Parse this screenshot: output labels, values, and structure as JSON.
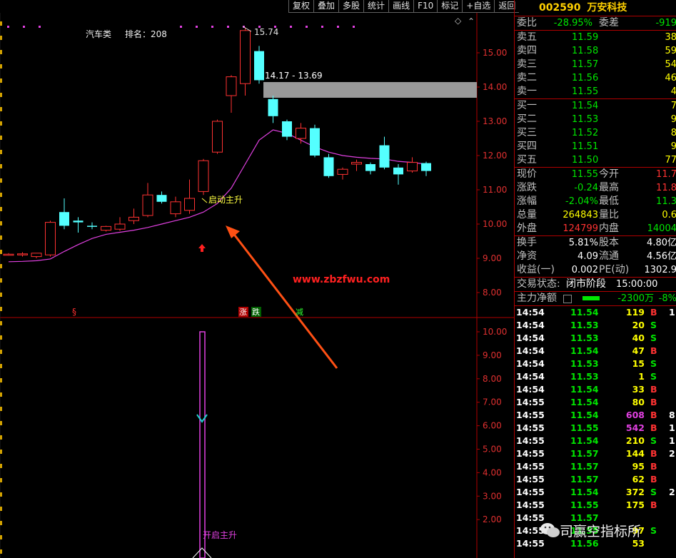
{
  "toolbar": [
    "复权",
    "叠加",
    "多股",
    "统计",
    "画线",
    "F10",
    "标记",
    "+自选",
    "返回"
  ],
  "chart": {
    "sector": "汽车类",
    "rank_label": "排名：208",
    "high_label": "15.74",
    "range_label": "14.17 - 13.69",
    "signal_label": "启动主升",
    "bottom_signal_label": "开启主升",
    "watermark": "www.zbzfwu.com",
    "marker_s": "§",
    "marker_zhang": "涨",
    "marker_die": "跌",
    "marker_jian": "减",
    "diamond": "◇",
    "price_ticks": [
      "15.00",
      "14.00",
      "13.00",
      "12.00",
      "11.00",
      "10.00",
      "9.00",
      "8.00"
    ],
    "lower_ticks": [
      "10.00",
      "9.00",
      "8.00",
      "7.00",
      "6.00",
      "5.00",
      "4.00",
      "3.00",
      "2.00"
    ],
    "colors": {
      "up": "#ff3232",
      "down": "#54ffff",
      "ma": "#e040e0",
      "grid": "#b00000",
      "arrow": "#ff5014"
    }
  },
  "candles": [
    {
      "o": 9.1,
      "h": 9.15,
      "l": 9.08,
      "c": 9.12
    },
    {
      "o": 9.1,
      "h": 9.18,
      "l": 9.05,
      "c": 9.13
    },
    {
      "o": 9.05,
      "h": 9.15,
      "l": 9.0,
      "c": 9.15
    },
    {
      "o": 9.1,
      "h": 10.1,
      "l": 9.05,
      "c": 10.05
    },
    {
      "o": 10.35,
      "h": 10.75,
      "l": 9.85,
      "c": 9.95
    },
    {
      "o": 10.1,
      "h": 10.2,
      "l": 9.75,
      "c": 10.05
    },
    {
      "o": 9.95,
      "h": 10.05,
      "l": 9.85,
      "c": 9.92
    },
    {
      "o": 9.82,
      "h": 9.95,
      "l": 9.78,
      "c": 9.93
    },
    {
      "o": 9.85,
      "h": 10.2,
      "l": 9.8,
      "c": 10.0
    },
    {
      "o": 10.1,
      "h": 10.45,
      "l": 10.0,
      "c": 10.2
    },
    {
      "o": 10.25,
      "h": 11.2,
      "l": 10.2,
      "c": 10.85
    },
    {
      "o": 10.85,
      "h": 10.95,
      "l": 10.6,
      "c": 10.65
    },
    {
      "o": 10.3,
      "h": 10.8,
      "l": 10.2,
      "c": 10.65
    },
    {
      "o": 10.4,
      "h": 11.3,
      "l": 10.3,
      "c": 10.75
    },
    {
      "o": 10.95,
      "h": 11.9,
      "l": 10.85,
      "c": 11.85
    },
    {
      "o": 12.1,
      "h": 13.05,
      "l": 12.05,
      "c": 13.0
    },
    {
      "o": 13.75,
      "h": 14.35,
      "l": 13.25,
      "c": 14.3
    },
    {
      "o": 14.1,
      "h": 15.74,
      "l": 13.75,
      "c": 15.65
    },
    {
      "o": 15.05,
      "h": 15.2,
      "l": 14.1,
      "c": 14.2
    },
    {
      "o": 13.65,
      "h": 13.75,
      "l": 12.95,
      "c": 13.15
    },
    {
      "o": 13.0,
      "h": 13.05,
      "l": 12.45,
      "c": 12.55
    },
    {
      "o": 12.5,
      "h": 12.95,
      "l": 12.35,
      "c": 12.8
    },
    {
      "o": 12.8,
      "h": 12.9,
      "l": 11.95,
      "c": 12.0
    },
    {
      "o": 11.95,
      "h": 12.05,
      "l": 11.35,
      "c": 11.4
    },
    {
      "o": 11.45,
      "h": 11.65,
      "l": 11.3,
      "c": 11.6
    },
    {
      "o": 11.75,
      "h": 11.88,
      "l": 11.55,
      "c": 11.8
    },
    {
      "o": 11.75,
      "h": 11.8,
      "l": 11.45,
      "c": 11.55
    },
    {
      "o": 12.3,
      "h": 12.55,
      "l": 11.6,
      "c": 11.65
    },
    {
      "o": 11.65,
      "h": 11.75,
      "l": 11.15,
      "c": 11.45
    },
    {
      "o": 11.55,
      "h": 11.95,
      "l": 11.5,
      "c": 11.8
    },
    {
      "o": 11.78,
      "h": 11.82,
      "l": 11.4,
      "c": 11.55
    }
  ],
  "ma": [
    8.9,
    8.91,
    8.93,
    8.98,
    9.2,
    9.4,
    9.58,
    9.7,
    9.76,
    9.82,
    9.9,
    10.0,
    10.1,
    10.2,
    10.35,
    10.6,
    11.05,
    11.75,
    12.45,
    12.75,
    12.65,
    12.45,
    12.25,
    12.1,
    12.0,
    11.95,
    11.92,
    11.9,
    11.83,
    11.8,
    11.75
  ],
  "stock": {
    "code": "002590",
    "name": "万安科技"
  },
  "order_ratio": {
    "label": "委比",
    "value": "-28.95%",
    "diff_label": "委差",
    "diff": "-919"
  },
  "asks": [
    {
      "label": "卖五",
      "price": "11.59",
      "vol": "38"
    },
    {
      "label": "卖四",
      "price": "11.58",
      "vol": "59"
    },
    {
      "label": "卖三",
      "price": "11.57",
      "vol": "54"
    },
    {
      "label": "卖二",
      "price": "11.56",
      "vol": "46"
    },
    {
      "label": "卖一",
      "price": "11.55",
      "vol": "4"
    }
  ],
  "bids": [
    {
      "label": "买一",
      "price": "11.54",
      "vol": "7"
    },
    {
      "label": "买二",
      "price": "11.53",
      "vol": "9"
    },
    {
      "label": "买三",
      "price": "11.52",
      "vol": "8"
    },
    {
      "label": "买四",
      "price": "11.51",
      "vol": "9"
    },
    {
      "label": "买五",
      "price": "11.50",
      "vol": "77"
    }
  ],
  "quote": [
    {
      "l1": "现价",
      "v1": "11.55",
      "c1": "grn",
      "l2": "今开",
      "v2": "11.7",
      "c2": "up"
    },
    {
      "l1": "涨跌",
      "v1": "-0.24",
      "c1": "grn",
      "l2": "最高",
      "v2": "11.8",
      "c2": "up"
    },
    {
      "l1": "涨幅",
      "v1": "-2.04%",
      "c1": "grn",
      "l2": "最低",
      "v2": "11.3",
      "c2": "grn"
    },
    {
      "l1": "总量",
      "v1": "264843",
      "c1": "yel",
      "l2": "量比",
      "v2": "0.6",
      "c2": "yel"
    },
    {
      "l1": "外盘",
      "v1": "124799",
      "c1": "up",
      "l2": "内盘",
      "v2": "14004",
      "c2": "grn"
    }
  ],
  "stats": [
    {
      "l1": "换手",
      "v1": "5.81%",
      "l2": "股本",
      "v2": "4.80亿"
    },
    {
      "l1": "净资",
      "v1": "4.09",
      "l2": "流通",
      "v2": "4.56亿"
    },
    {
      "l1": "收益(一)",
      "v1": "0.002",
      "l2": "PE(动)",
      "v2": "1302.9"
    }
  ],
  "trade_status": {
    "label": "交易状态:",
    "value": "闭市阶段",
    "time": "15:00:00"
  },
  "main_flow": {
    "label": "主力净额",
    "value": "-2300万",
    "pct": "-8%"
  },
  "trades": [
    {
      "t": "14:54",
      "p": "11.54",
      "v": "119",
      "d": "B",
      "x": "1"
    },
    {
      "t": "14:54",
      "p": "11.53",
      "v": "20",
      "d": "S",
      "x": ""
    },
    {
      "t": "14:54",
      "p": "11.53",
      "v": "40",
      "d": "S",
      "x": ""
    },
    {
      "t": "14:54",
      "p": "11.54",
      "v": "47",
      "d": "B",
      "x": ""
    },
    {
      "t": "14:54",
      "p": "11.53",
      "v": "15",
      "d": "S",
      "x": ""
    },
    {
      "t": "14:54",
      "p": "11.53",
      "v": "1",
      "d": "S",
      "x": ""
    },
    {
      "t": "14:54",
      "p": "11.54",
      "v": "33",
      "d": "B",
      "x": ""
    },
    {
      "t": "14:55",
      "p": "11.54",
      "v": "80",
      "d": "B",
      "x": ""
    },
    {
      "t": "14:55",
      "p": "11.54",
      "v": "608",
      "d": "B",
      "x": "8"
    },
    {
      "t": "14:55",
      "p": "11.55",
      "v": "542",
      "d": "B",
      "x": "1"
    },
    {
      "t": "14:55",
      "p": "11.54",
      "v": "210",
      "d": "S",
      "x": "1"
    },
    {
      "t": "14:55",
      "p": "11.57",
      "v": "144",
      "d": "B",
      "x": "2"
    },
    {
      "t": "14:55",
      "p": "11.57",
      "v": "95",
      "d": "B",
      "x": ""
    },
    {
      "t": "14:55",
      "p": "11.57",
      "v": "62",
      "d": "B",
      "x": ""
    },
    {
      "t": "14:55",
      "p": "11.54",
      "v": "372",
      "d": "S",
      "x": "2"
    },
    {
      "t": "14:55",
      "p": "11.55",
      "v": "175",
      "d": "B",
      "x": ""
    },
    {
      "t": "14:55",
      "p": "11.57",
      "v": "",
      "d": "",
      "x": ""
    },
    {
      "t": "14:55",
      "p": "11.55",
      "v": "97",
      "d": "S",
      "x": ""
    },
    {
      "t": "14:55",
      "p": "11.56",
      "v": "53",
      "d": "",
      "x": ""
    }
  ],
  "watermark_brand": "司赢空指标所"
}
